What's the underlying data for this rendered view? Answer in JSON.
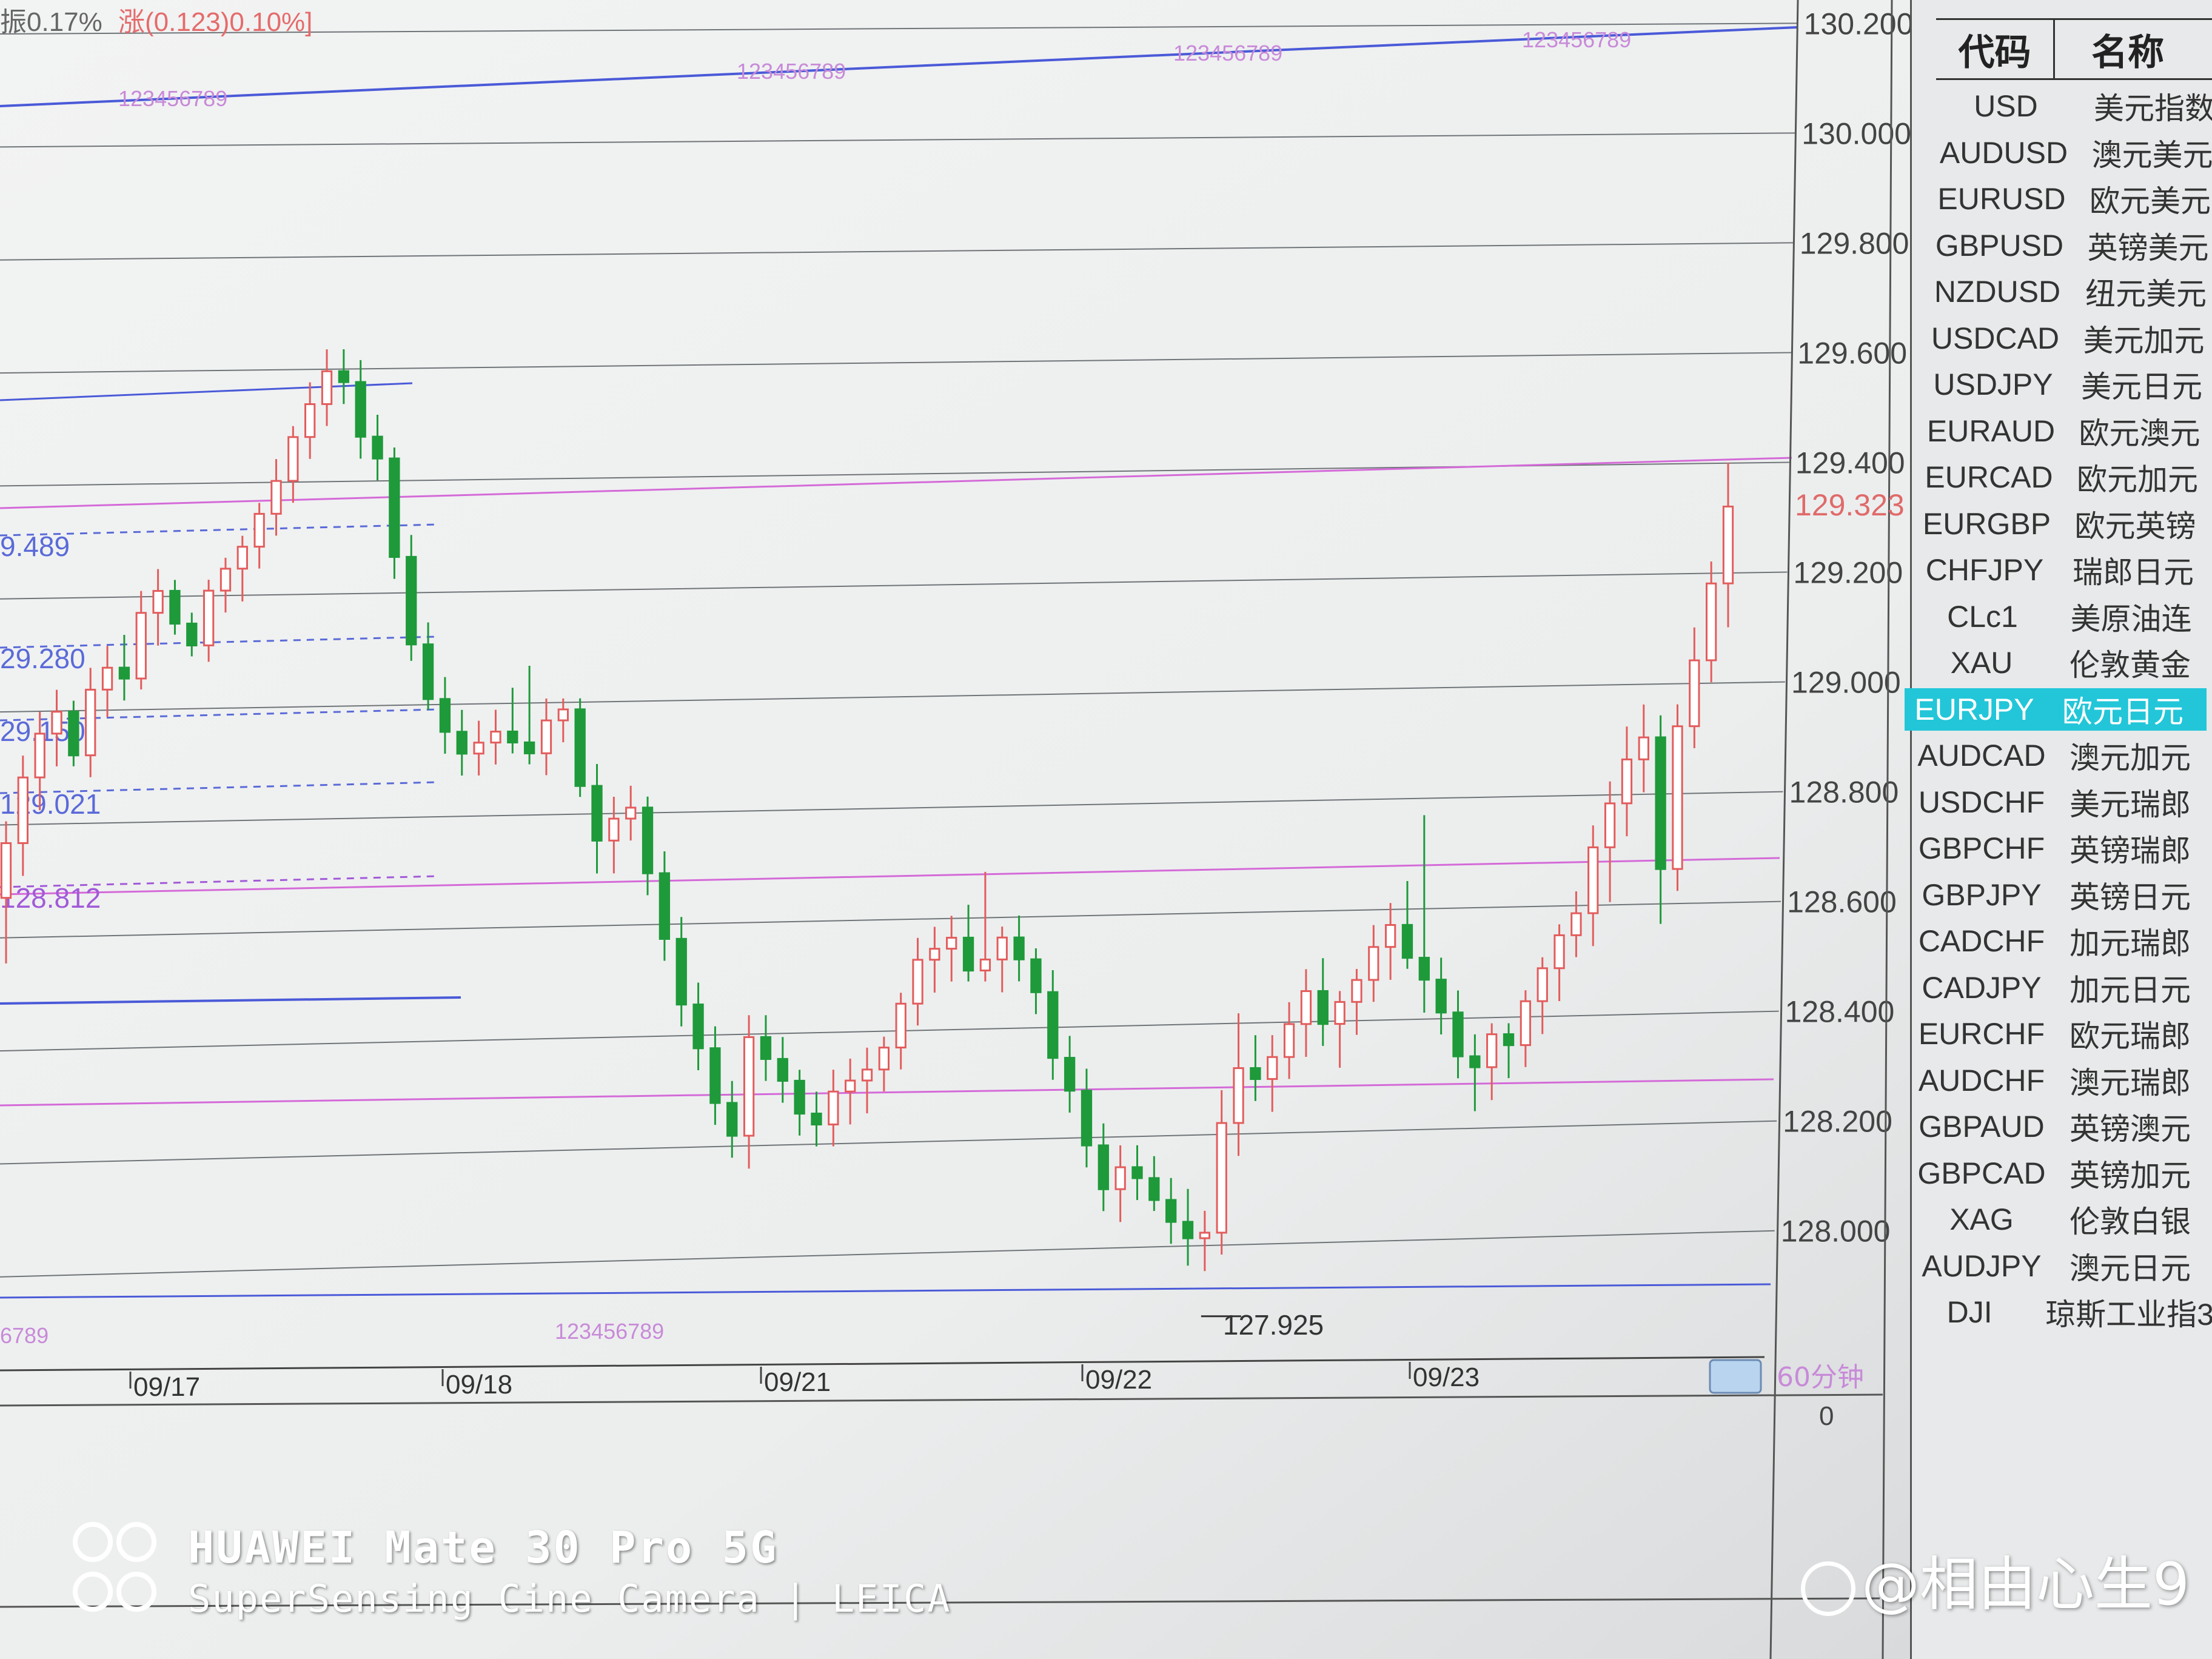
{
  "status": {
    "amplitude": "振0.17%",
    "change": "涨(0.123)0.10%]"
  },
  "watchlist": {
    "headers": {
      "code": "代码",
      "name": "名称"
    },
    "items": [
      {
        "code": "USD",
        "name": "美元指数"
      },
      {
        "code": "AUDUSD",
        "name": "澳元美元"
      },
      {
        "code": "EURUSD",
        "name": "欧元美元"
      },
      {
        "code": "GBPUSD",
        "name": "英镑美元"
      },
      {
        "code": "NZDUSD",
        "name": "纽元美元"
      },
      {
        "code": "USDCAD",
        "name": "美元加元"
      },
      {
        "code": "USDJPY",
        "name": "美元日元"
      },
      {
        "code": "EURAUD",
        "name": "欧元澳元"
      },
      {
        "code": "EURCAD",
        "name": "欧元加元"
      },
      {
        "code": "EURGBP",
        "name": "欧元英镑"
      },
      {
        "code": "CHFJPY",
        "name": "瑞郎日元"
      },
      {
        "code": "CLc1",
        "name": "美原油连"
      },
      {
        "code": "XAU",
        "name": "伦敦黄金"
      },
      {
        "code": "EURJPY",
        "name": "欧元日元"
      },
      {
        "code": "AUDCAD",
        "name": "澳元加元"
      },
      {
        "code": "USDCHF",
        "name": "美元瑞郎"
      },
      {
        "code": "GBPCHF",
        "name": "英镑瑞郎"
      },
      {
        "code": "GBPJPY",
        "name": "英镑日元"
      },
      {
        "code": "CADCHF",
        "name": "加元瑞郎"
      },
      {
        "code": "CADJPY",
        "name": "加元日元"
      },
      {
        "code": "EURCHF",
        "name": "欧元瑞郎"
      },
      {
        "code": "AUDCHF",
        "name": "澳元瑞郎"
      },
      {
        "code": "GBPAUD",
        "name": "英镑澳元"
      },
      {
        "code": "GBPCAD",
        "name": "英镑加元"
      },
      {
        "code": "XAG",
        "name": "伦敦白银"
      },
      {
        "code": "AUDJPY",
        "name": "澳元日元"
      },
      {
        "code": "DJI",
        "name": "琼斯工业指3"
      }
    ],
    "selected_index": 13
  },
  "chart": {
    "price_labels": [
      "130.200",
      "130.000",
      "129.800",
      "129.600",
      "129.400",
      "129.200",
      "129.000",
      "128.800",
      "128.600",
      "128.400",
      "128.200",
      "128.000"
    ],
    "current_price": "129.323",
    "low_label": "127.925",
    "level_labels": [
      "9.489",
      "29.280",
      "29.150",
      "129.021",
      "128.812"
    ],
    "date_labels": [
      "09/17",
      "09/18",
      "09/21",
      "09/22",
      "09/23"
    ],
    "period_label": "60分钟",
    "volume_zero": "0",
    "fib_labels": [
      "123456789",
      "123456789",
      "123456789",
      "123456789",
      "6789",
      "123456789"
    ]
  },
  "overlay": {
    "camera_line1": "HUAWEI Mate 30 Pro 5G",
    "camera_line2": "SuperSensing Cine Camera | LEICA",
    "watermark": "@相由心生9"
  },
  "chart_data": {
    "type": "candlestick",
    "y_unit": "price",
    "ylim": [
      127.9,
      130.22
    ],
    "series": [
      {
        "name": "EURJPY",
        "ohlc": [
          [
            128.62,
            128.76,
            128.5,
            128.72
          ],
          [
            128.72,
            128.88,
            128.66,
            128.84
          ],
          [
            128.84,
            128.96,
            128.78,
            128.92
          ],
          [
            128.92,
            129.0,
            128.86,
            128.96
          ],
          [
            128.96,
            128.98,
            128.86,
            128.88
          ],
          [
            128.88,
            129.04,
            128.84,
            129.0
          ],
          [
            129.0,
            129.08,
            128.95,
            129.04
          ],
          [
            129.04,
            129.1,
            128.98,
            129.02
          ],
          [
            129.02,
            129.18,
            129.0,
            129.14
          ],
          [
            129.14,
            129.22,
            129.08,
            129.18
          ],
          [
            129.18,
            129.2,
            129.1,
            129.12
          ],
          [
            129.12,
            129.14,
            129.06,
            129.08
          ],
          [
            129.08,
            129.2,
            129.05,
            129.18
          ],
          [
            129.18,
            129.24,
            129.14,
            129.22
          ],
          [
            129.22,
            129.28,
            129.16,
            129.26
          ],
          [
            129.26,
            129.34,
            129.22,
            129.32
          ],
          [
            129.32,
            129.42,
            129.28,
            129.38
          ],
          [
            129.38,
            129.48,
            129.34,
            129.46
          ],
          [
            129.46,
            129.56,
            129.42,
            129.52
          ],
          [
            129.52,
            129.62,
            129.48,
            129.58
          ],
          [
            129.58,
            129.62,
            129.52,
            129.56
          ],
          [
            129.56,
            129.6,
            129.42,
            129.46
          ],
          [
            129.46,
            129.5,
            129.38,
            129.42
          ],
          [
            129.42,
            129.44,
            129.2,
            129.24
          ],
          [
            129.24,
            129.28,
            129.05,
            129.08
          ],
          [
            129.08,
            129.12,
            128.96,
            128.98
          ],
          [
            128.98,
            129.02,
            128.88,
            128.92
          ],
          [
            128.92,
            128.96,
            128.84,
            128.88
          ],
          [
            128.88,
            128.94,
            128.84,
            128.9
          ],
          [
            128.9,
            128.96,
            128.86,
            128.92
          ],
          [
            128.92,
            129.0,
            128.88,
            128.9
          ],
          [
            128.9,
            129.04,
            128.86,
            128.88
          ],
          [
            128.88,
            128.98,
            128.84,
            128.94
          ],
          [
            128.94,
            128.98,
            128.9,
            128.96
          ],
          [
            128.96,
            128.98,
            128.8,
            128.82
          ],
          [
            128.82,
            128.86,
            128.66,
            128.72
          ],
          [
            128.72,
            128.8,
            128.66,
            128.76
          ],
          [
            128.76,
            128.82,
            128.72,
            128.78
          ],
          [
            128.78,
            128.8,
            128.62,
            128.66
          ],
          [
            128.66,
            128.7,
            128.5,
            128.54
          ],
          [
            128.54,
            128.58,
            128.38,
            128.42
          ],
          [
            128.42,
            128.46,
            128.3,
            128.34
          ],
          [
            128.34,
            128.38,
            128.2,
            128.24
          ],
          [
            128.24,
            128.28,
            128.14,
            128.18
          ],
          [
            128.18,
            128.4,
            128.12,
            128.36
          ],
          [
            128.36,
            128.4,
            128.28,
            128.32
          ],
          [
            128.32,
            128.36,
            128.24,
            128.28
          ],
          [
            128.28,
            128.3,
            128.18,
            128.22
          ],
          [
            128.22,
            128.26,
            128.16,
            128.2
          ],
          [
            128.2,
            128.3,
            128.16,
            128.26
          ],
          [
            128.26,
            128.32,
            128.2,
            128.28
          ],
          [
            128.28,
            128.34,
            128.22,
            128.3
          ],
          [
            128.3,
            128.36,
            128.26,
            128.34
          ],
          [
            128.34,
            128.44,
            128.3,
            128.42
          ],
          [
            128.42,
            128.54,
            128.38,
            128.5
          ],
          [
            128.5,
            128.56,
            128.44,
            128.52
          ],
          [
            128.52,
            128.58,
            128.46,
            128.54
          ],
          [
            128.54,
            128.6,
            128.46,
            128.48
          ],
          [
            128.48,
            128.66,
            128.46,
            128.5
          ],
          [
            128.5,
            128.56,
            128.44,
            128.54
          ],
          [
            128.54,
            128.58,
            128.46,
            128.5
          ],
          [
            128.5,
            128.52,
            128.4,
            128.44
          ],
          [
            128.44,
            128.48,
            128.28,
            128.32
          ],
          [
            128.32,
            128.36,
            128.22,
            128.26
          ],
          [
            128.26,
            128.3,
            128.12,
            128.16
          ],
          [
            128.16,
            128.2,
            128.04,
            128.08
          ],
          [
            128.08,
            128.16,
            128.02,
            128.12
          ],
          [
            128.12,
            128.16,
            128.06,
            128.1
          ],
          [
            128.1,
            128.14,
            128.04,
            128.06
          ],
          [
            128.06,
            128.1,
            127.98,
            128.02
          ],
          [
            128.02,
            128.08,
            127.94,
            127.99
          ],
          [
            127.99,
            128.04,
            127.93,
            128.0
          ],
          [
            128.0,
            128.26,
            127.96,
            128.2
          ],
          [
            128.2,
            128.4,
            128.14,
            128.3
          ],
          [
            128.3,
            128.36,
            128.24,
            128.28
          ],
          [
            128.28,
            128.36,
            128.22,
            128.32
          ],
          [
            128.32,
            128.42,
            128.28,
            128.38
          ],
          [
            128.38,
            128.48,
            128.32,
            128.44
          ],
          [
            128.44,
            128.5,
            128.34,
            128.38
          ],
          [
            128.38,
            128.44,
            128.3,
            128.42
          ],
          [
            128.42,
            128.48,
            128.36,
            128.46
          ],
          [
            128.46,
            128.56,
            128.42,
            128.52
          ],
          [
            128.52,
            128.6,
            128.46,
            128.56
          ],
          [
            128.56,
            128.64,
            128.48,
            128.5
          ],
          [
            128.5,
            128.76,
            128.4,
            128.46
          ],
          [
            128.46,
            128.5,
            128.36,
            128.4
          ],
          [
            128.4,
            128.44,
            128.28,
            128.32
          ],
          [
            128.32,
            128.36,
            128.22,
            128.3
          ],
          [
            128.3,
            128.38,
            128.24,
            128.36
          ],
          [
            128.36,
            128.38,
            128.28,
            128.34
          ],
          [
            128.34,
            128.44,
            128.3,
            128.42
          ],
          [
            128.42,
            128.5,
            128.36,
            128.48
          ],
          [
            128.48,
            128.56,
            128.42,
            128.54
          ],
          [
            128.54,
            128.62,
            128.5,
            128.58
          ],
          [
            128.58,
            128.74,
            128.52,
            128.7
          ],
          [
            128.7,
            128.82,
            128.6,
            128.78
          ],
          [
            128.78,
            128.92,
            128.72,
            128.86
          ],
          [
            128.86,
            128.96,
            128.8,
            128.9
          ],
          [
            128.9,
            128.94,
            128.56,
            128.66
          ],
          [
            128.66,
            128.96,
            128.62,
            128.92
          ],
          [
            128.92,
            129.1,
            128.88,
            129.04
          ],
          [
            129.04,
            129.22,
            129.0,
            129.18
          ],
          [
            129.18,
            129.4,
            129.1,
            129.32
          ]
        ]
      }
    ]
  }
}
